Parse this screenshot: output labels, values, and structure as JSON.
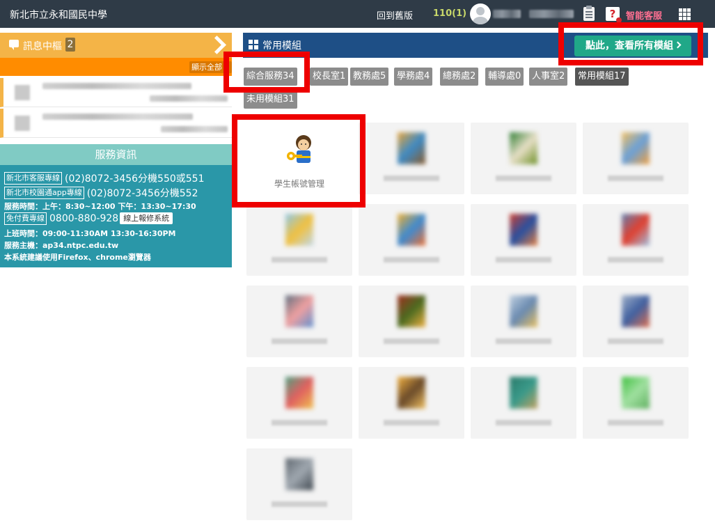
{
  "topbar": {
    "school": "新北市立永和國民中學",
    "back_old": "回到舊版",
    "year": "110(1)",
    "ai_service": "智能客服"
  },
  "messages": {
    "title": "訊息中樞",
    "count": "2",
    "show_all": "顯示全部"
  },
  "service": {
    "title": "服務資訊",
    "hotline_label": "新北市客服專線",
    "hotline_value": "(02)8072-3456分機550或551",
    "app_label": "新北市校園通app專線",
    "app_value": "(02)8072-3456分機552",
    "hours": "服務時間：上午：8:30~12:00 下午：13:30~17:30",
    "free_label": "免付費專線",
    "free_value": "0800-880-928",
    "repair_btn": "線上報修系統",
    "work_hours": "上班時間：09:00-11:30AM 13:30-16:30PM",
    "host": "服務主機：ap34.ntpc.edu.tw",
    "browser": "本系統建議使用Firefox、chrome瀏覽器"
  },
  "modules": {
    "title": "常用模組",
    "view_all": "點此，查看所有模組",
    "tabs": [
      "綜合服務34",
      "校長室1",
      "教務處5",
      "學務處4",
      "總務處2",
      "輔導處0",
      "人事室2",
      "常用模組17",
      "未用模組31"
    ],
    "first_tile_label": "學生帳號管理"
  },
  "colors": {
    "topbar": "#2f3b47",
    "message_header": "#f4b447",
    "orange_bar": "#ff8c00",
    "service_header": "#80cbc4",
    "service_body": "#2a97a8",
    "module_header": "#1e4f86",
    "view_all_button": "#20a888",
    "highlight": "#ee0000"
  }
}
